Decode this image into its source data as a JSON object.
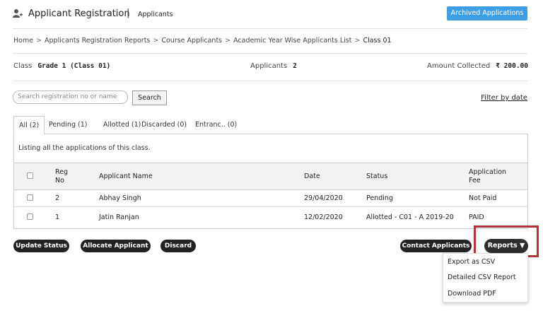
{
  "header": {
    "title": "Applicant Registration",
    "separator": "|",
    "subtitle": "Applicants",
    "archived_button": "Archived Applications"
  },
  "breadcrumb": [
    "Home",
    "Applicants Registration Reports",
    "Course Applicants",
    "Academic Year Wise Applicants List",
    "Class 01"
  ],
  "breadcrumb_separator": ">",
  "info": {
    "class_label": "Class",
    "class_value": "Grade 1 (Class 01)",
    "applicants_label": "Applicants",
    "applicants_value": "2",
    "amount_label": "Amount Collected",
    "amount_value": "₹ 200.00"
  },
  "search": {
    "placeholder": "Search registration no or name",
    "button": "Search",
    "filter_link": "Filter by date"
  },
  "tabs": [
    {
      "label": "All (2)",
      "active": true
    },
    {
      "label": "Pending (1)",
      "active": false
    },
    {
      "label": "Allotted (1)",
      "active": false
    },
    {
      "label": "Discarded (0)",
      "active": false
    },
    {
      "label": "Entranc.. (0)",
      "active": false
    }
  ],
  "panel_note": "Listing all the applications of this class.",
  "table": {
    "headers": [
      "Reg No",
      "Applicant Name",
      "Date",
      "Status",
      "Application Fee"
    ],
    "rows": [
      {
        "reg": "2",
        "name": "Abhay Singh",
        "date": "29/04/2020",
        "status": "Pending",
        "fee": "Not Paid"
      },
      {
        "reg": "1",
        "name": "Jatin Ranjan",
        "date": "12/02/2020",
        "status": "Allotted - C01 - A 2019-20",
        "fee": "PAID"
      }
    ]
  },
  "actions": {
    "update_status": "Update Status",
    "allocate": "Allocate Applicant",
    "discard": "Discard",
    "contact": "Contact Applicants",
    "reports": "Reports ▼"
  },
  "reports_menu": [
    "Export as CSV",
    "Detailed CSV Report",
    "Download PDF"
  ],
  "colors": {
    "accent": "#3f9fe6",
    "dark_button": "#222222",
    "highlight": "#b5313b"
  }
}
